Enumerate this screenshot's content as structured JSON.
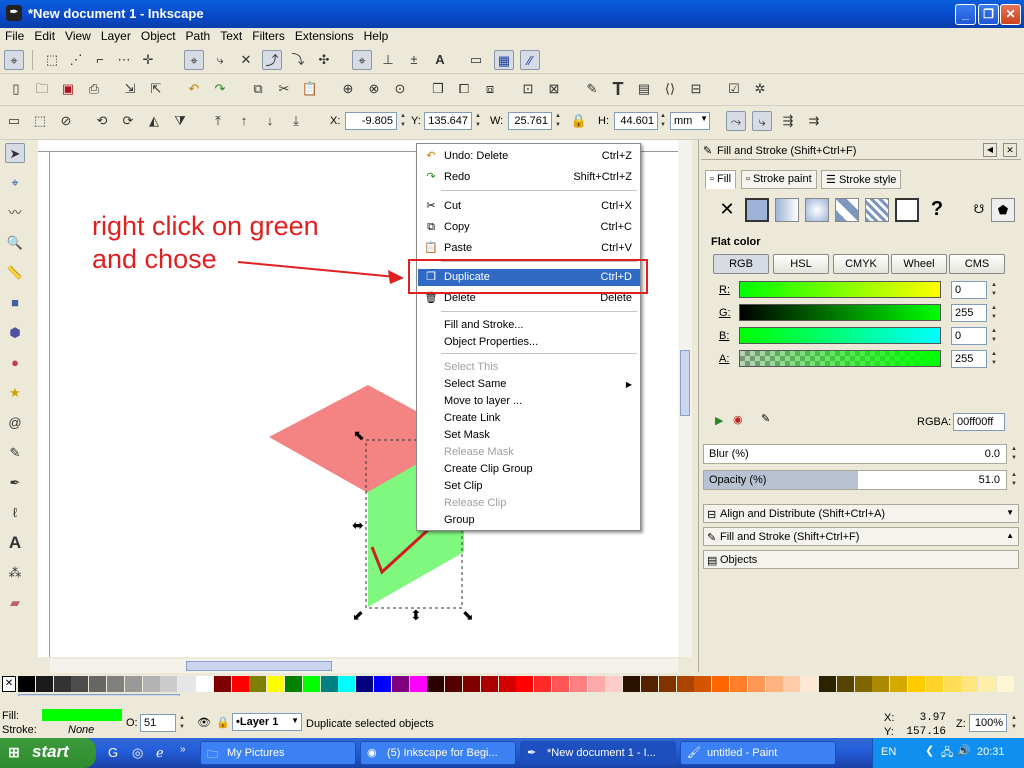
{
  "window": {
    "title": "*New document 1 - Inkscape"
  },
  "menubar": [
    "File",
    "Edit",
    "View",
    "Layer",
    "Object",
    "Path",
    "Text",
    "Filters",
    "Extensions",
    "Help"
  ],
  "select_toolbar": {
    "x_label": "X:",
    "x_value": "-9.805",
    "y_label": "Y:",
    "y_value": "135.647",
    "w_label": "W:",
    "w_value": "25.761",
    "h_label": "H:",
    "h_value": "44.601",
    "unit": "mm"
  },
  "annotation": {
    "line1": "right click on green",
    "line2": "and chose"
  },
  "context_menu": {
    "items": [
      {
        "label": "Undo: Delete",
        "accel": "Ctrl+Z",
        "icon": "undo-icon",
        "state": "normal"
      },
      {
        "label": "Redo",
        "accel": "Shift+Ctrl+Z",
        "icon": "redo-icon",
        "state": "normal"
      },
      {
        "label": "Cut",
        "accel": "Ctrl+X",
        "icon": "cut-icon",
        "state": "normal"
      },
      {
        "label": "Copy",
        "accel": "Ctrl+C",
        "icon": "copy-icon",
        "state": "normal"
      },
      {
        "label": "Paste",
        "accel": "Ctrl+V",
        "icon": "paste-icon",
        "state": "normal"
      },
      {
        "label": "Duplicate",
        "accel": "Ctrl+D",
        "icon": "duplicate-icon",
        "state": "highlighted"
      },
      {
        "label": "Delete",
        "accel": "Delete",
        "icon": "delete-icon",
        "state": "normal"
      },
      {
        "label": "Fill and Stroke...",
        "accel": "",
        "icon": "",
        "state": "normal"
      },
      {
        "label": "Object Properties...",
        "accel": "",
        "icon": "",
        "state": "normal"
      },
      {
        "label": "Select This",
        "accel": "",
        "icon": "",
        "state": "disabled"
      },
      {
        "label": "Select Same",
        "accel": "",
        "icon": "",
        "state": "normal",
        "submenu": true
      },
      {
        "label": "Move to layer ...",
        "accel": "",
        "icon": "",
        "state": "normal"
      },
      {
        "label": "Create Link",
        "accel": "",
        "icon": "",
        "state": "normal"
      },
      {
        "label": "Set Mask",
        "accel": "",
        "icon": "",
        "state": "normal"
      },
      {
        "label": "Release Mask",
        "accel": "",
        "icon": "",
        "state": "disabled"
      },
      {
        "label": "Create Clip Group",
        "accel": "",
        "icon": "",
        "state": "normal"
      },
      {
        "label": "Set Clip",
        "accel": "",
        "icon": "",
        "state": "normal"
      },
      {
        "label": "Release Clip",
        "accel": "",
        "icon": "",
        "state": "disabled"
      },
      {
        "label": "Group",
        "accel": "",
        "icon": "",
        "state": "normal"
      }
    ]
  },
  "fill_stroke_panel": {
    "title": "Fill and Stroke (Shift+Ctrl+F)",
    "tabs": [
      "Fill",
      "Stroke paint",
      "Stroke style"
    ],
    "flat_color_label": "Flat color",
    "modes": [
      "RGB",
      "HSL",
      "CMYK",
      "Wheel",
      "CMS"
    ],
    "channels": [
      {
        "label": "R:",
        "value": "0"
      },
      {
        "label": "G:",
        "value": "255"
      },
      {
        "label": "B:",
        "value": "0"
      },
      {
        "label": "A:",
        "value": "255"
      }
    ],
    "rgba_label": "RGBA:",
    "rgba_value": "00ff00ff",
    "blur_label": "Blur (%)",
    "blur_value": "0.0",
    "opacity_label": "Opacity (%)",
    "opacity_value": "51.0",
    "opacity_fraction": 0.51
  },
  "docked_dialogs": [
    "Align and Distribute (Shift+Ctrl+A)",
    "Fill and Stroke (Shift+Ctrl+F)",
    "Objects"
  ],
  "statusbar": {
    "fill_label": "Fill:",
    "stroke_label": "Stroke:",
    "stroke_value": "None",
    "o_label": "O:",
    "o_value": "51",
    "layer": "•Layer 1",
    "message": "Duplicate selected objects",
    "x_label": "X:",
    "x_value": "3.97",
    "y_label": "Y:",
    "y_value": "157.16",
    "zoom_label": "Z:",
    "zoom_value": "100%"
  },
  "taskbar": {
    "start": "start",
    "tasks": [
      "My Pictures",
      "(5) Inkscape for Begi...",
      "*New document 1 - I...",
      "untitled - Paint"
    ],
    "lang": "EN",
    "clock": "20:31"
  },
  "colors": {
    "fill": "#00ff00",
    "shape_pink": "#f48484",
    "shape_green": "#80f880",
    "annotation_red": "#e02020",
    "menu_highlight": "#316ac5"
  }
}
